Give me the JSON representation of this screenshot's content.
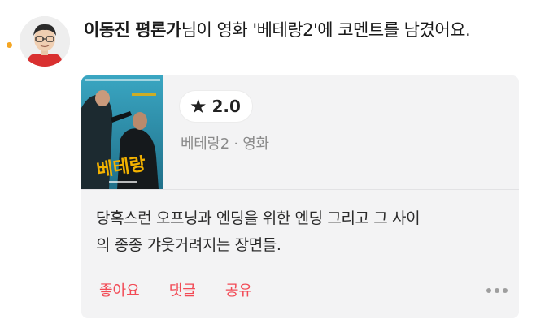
{
  "feed_item": {
    "author": "이동진 평론가",
    "headline_rest": "님이 영화 '베테랑2'에 코멘트를 남겼어요.",
    "rating": "2.0",
    "movie_meta": "베테랑2 · 영화",
    "poster_title": "베테랑",
    "comment_line1": "당혹스런 오프닝과 엔딩을 위한 엔딩 그리고 그 사이",
    "comment_line2": "의 종종 갸웃거려지는 장면들.",
    "actions": {
      "like": "좋아요",
      "reply": "댓글",
      "share": "공유"
    }
  },
  "icons": {
    "star": "star-icon",
    "more": "more-icon"
  },
  "colors": {
    "accent": "#f24a55",
    "unread_dot": "#f5a623",
    "card_bg": "#f3f3f4",
    "poster_bg": "#2f8fa8",
    "poster_title": "#f2b100"
  }
}
